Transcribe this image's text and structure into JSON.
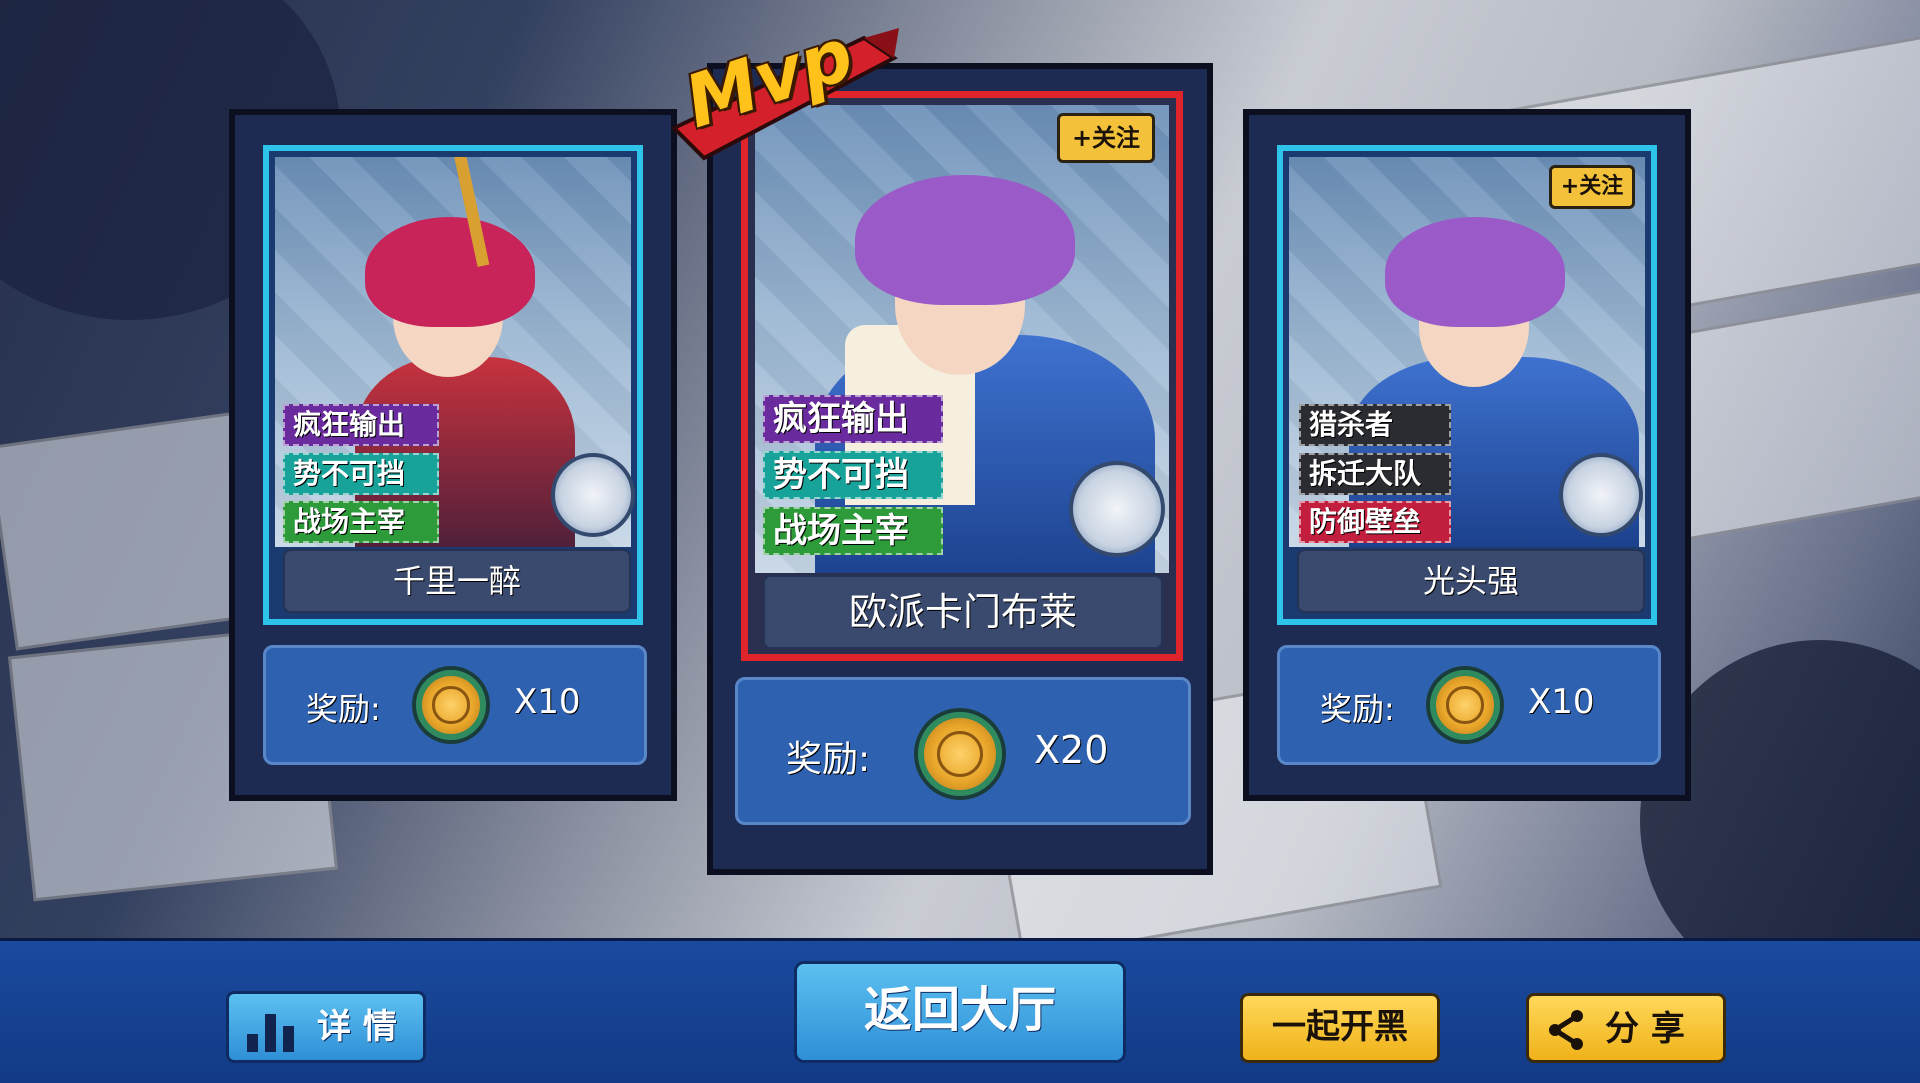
{
  "mvp_label": "Mvp",
  "cards": [
    {
      "name": "千里一醉",
      "tags": [
        "疯狂输出",
        "势不可挡",
        "战场主宰"
      ],
      "reward_label": "奖励:",
      "reward_count": "X10",
      "has_follow": false
    },
    {
      "name": "欧派卡门布莱",
      "tags": [
        "疯狂输出",
        "势不可挡",
        "战场主宰"
      ],
      "reward_label": "奖励:",
      "reward_count": "X20",
      "follow_label": "+关注",
      "has_follow": true
    },
    {
      "name": "光头强",
      "tags": [
        "猎杀者",
        "拆迁大队",
        "防御壁垒"
      ],
      "reward_label": "奖励:",
      "reward_count": "X10",
      "follow_label": "+关注",
      "has_follow": true
    }
  ],
  "bottom": {
    "details_label": "详 情",
    "back_label": "返回大厅",
    "team_label": "一起开黑",
    "share_label": "分 享"
  },
  "colors": {
    "mvp_frame": "#e0252a",
    "side_frame": "#2ec4ea",
    "tag_purple": "#6a2b9e",
    "tag_teal": "#17a39a",
    "tag_green": "#2d9b3a",
    "tag_dark": "#2b2b32",
    "tag_red": "#c21e3e"
  }
}
